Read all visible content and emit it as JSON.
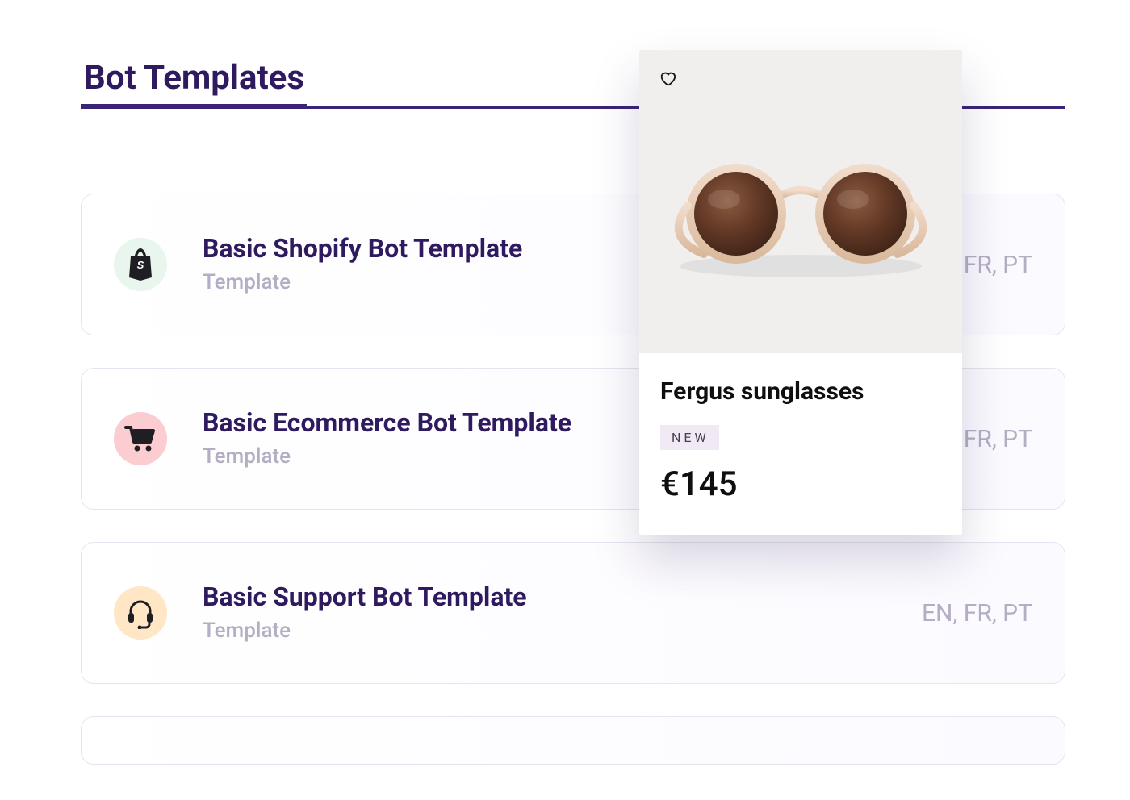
{
  "page": {
    "title": "Bot Templates"
  },
  "templates": [
    {
      "name": "Basic Shopify Bot Template",
      "subtitle": "Template",
      "langs": "EN, FR, PT",
      "icon": "shopify-bag-icon",
      "iconBg": "green"
    },
    {
      "name": "Basic Ecommerce Bot Template",
      "subtitle": "Template",
      "langs": "EN, FR, PT",
      "icon": "cart-icon",
      "iconBg": "pink"
    },
    {
      "name": "Basic Support Bot Template",
      "subtitle": "Template",
      "langs": "EN, FR, PT",
      "icon": "headset-icon",
      "iconBg": "peach"
    }
  ],
  "product": {
    "name": "Fergus sunglasses",
    "badge": "NEW",
    "price": "€145"
  }
}
